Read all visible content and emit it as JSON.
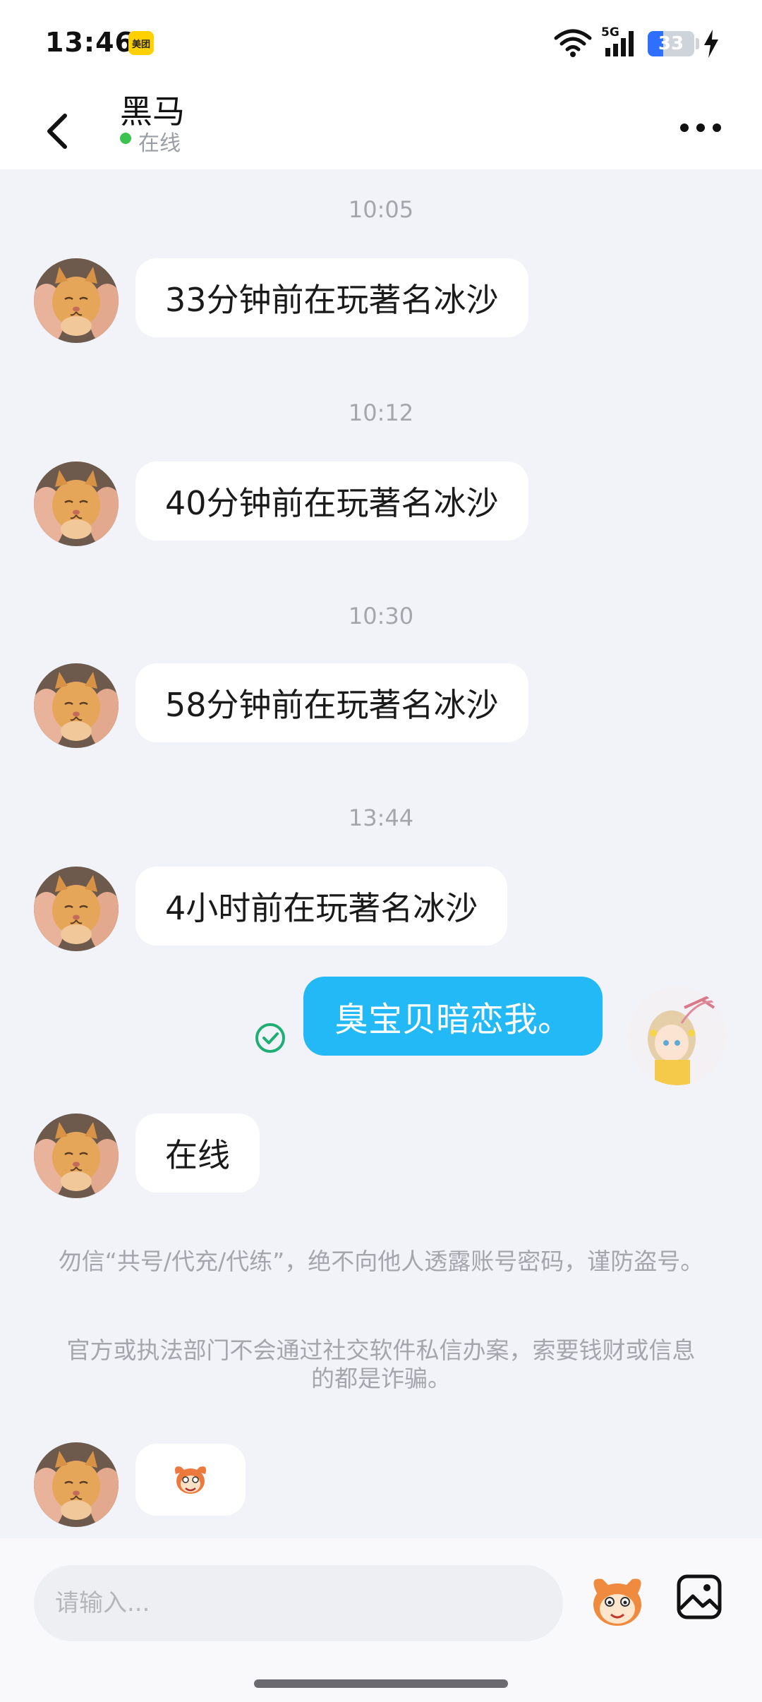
{
  "status_bar": {
    "time": "13:46",
    "app_badge": "美团",
    "network": "5G",
    "battery_level": 33,
    "battery_text": "33"
  },
  "header": {
    "contact_name": "黑马",
    "status": "在线"
  },
  "messages": [
    {
      "timestamp": "10:05",
      "text": "33分钟前在玩著名冰沙"
    },
    {
      "timestamp": "10:12",
      "text": "40分钟前在玩著名冰沙"
    },
    {
      "timestamp": "10:30",
      "text": "58分钟前在玩著名冰沙"
    },
    {
      "timestamp": "13:44",
      "text": "4小时前在玩著名冰沙"
    }
  ],
  "my_message": {
    "text": "臭宝贝暗恋我。"
  },
  "reply": {
    "text": "在线"
  },
  "notices": {
    "warning1": "勿信“共号/代充/代练”，绝不向他人透露账号密码，谨防盗号。",
    "warning2": "官方或执法部门不会通过社交软件私信办案，索要钱财或信息的都是诈骗。"
  },
  "input": {
    "placeholder": "请输入..."
  },
  "colors": {
    "accent_bubble": "#23b8f6",
    "online_dot": "#3cc24f",
    "background": "#f2f3f8"
  }
}
